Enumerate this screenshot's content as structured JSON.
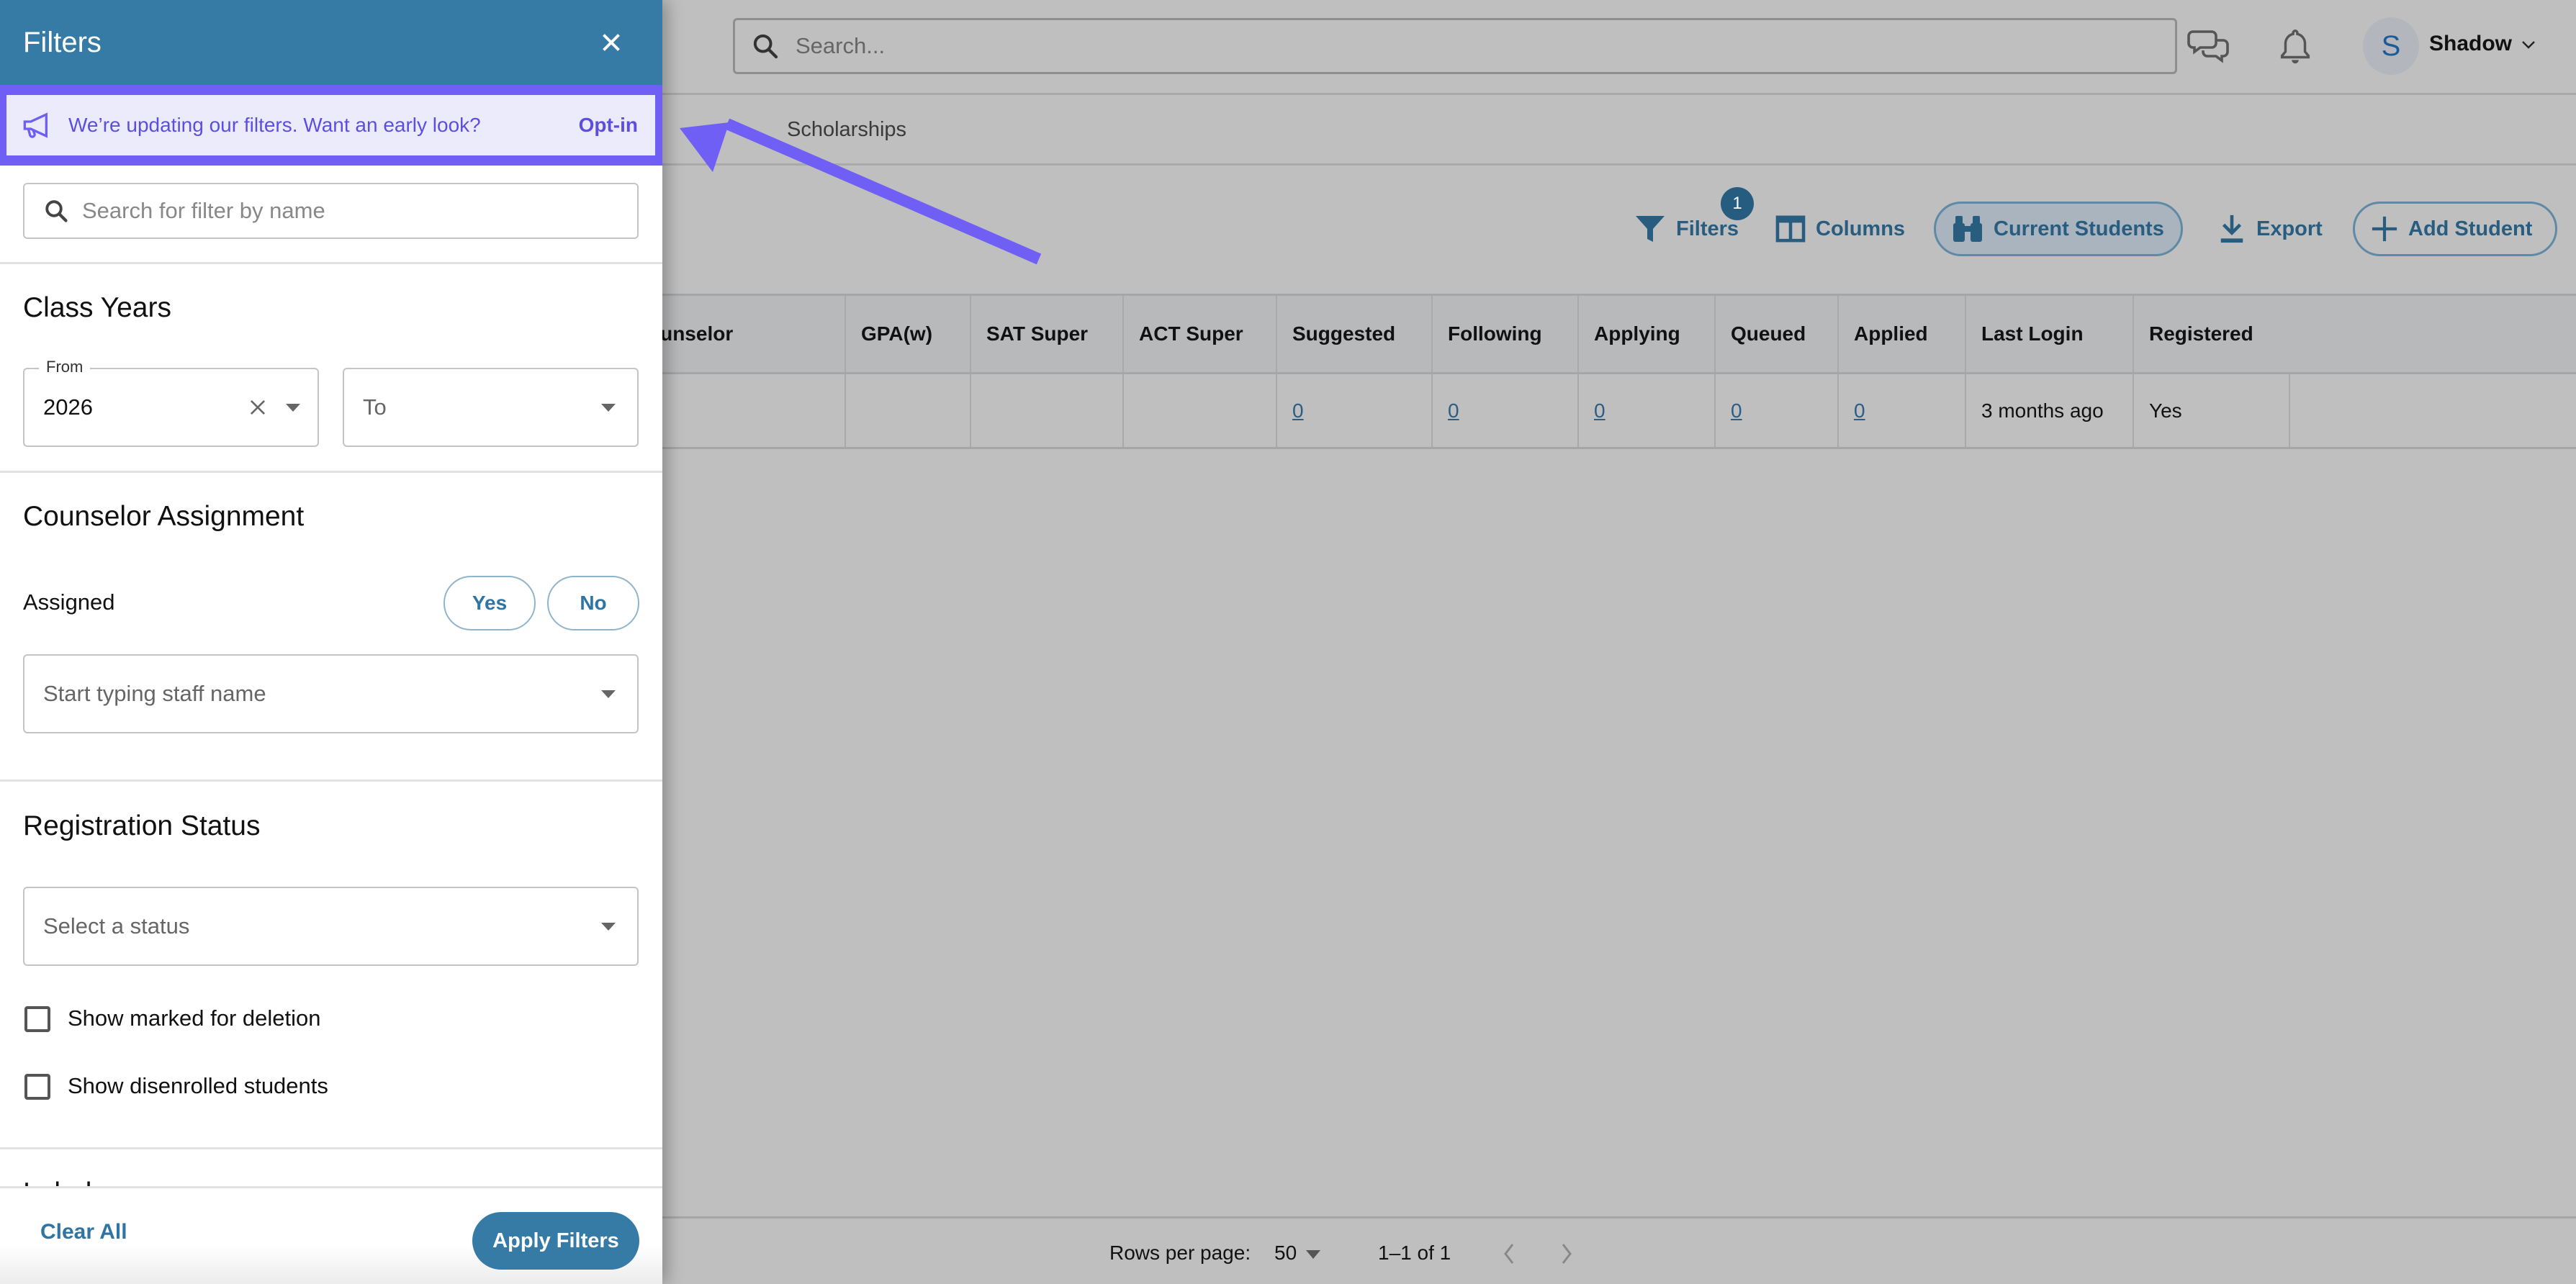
{
  "header": {
    "search_placeholder": "Search...",
    "user_initial": "S",
    "user_name": "Shadow"
  },
  "tabs": [
    {
      "label": "Scholarships"
    }
  ],
  "toolbar": {
    "filters_label": "Filters",
    "filters_badge": "1",
    "columns_label": "Columns",
    "current_students_label": "Current Students",
    "export_label": "Export",
    "add_student_label": "Add Student"
  },
  "table": {
    "columns": [
      "ounselor",
      "GPA(w)",
      "SAT Super",
      "ACT Super",
      "Suggested",
      "Following",
      "Applying",
      "Queued",
      "Applied",
      "Last Login",
      "Registered"
    ],
    "rows": [
      {
        "counselor": "",
        "gpa": "",
        "sat": "",
        "act": "",
        "suggested": "0",
        "following": "0",
        "applying": "0",
        "queued": "0",
        "applied": "0",
        "last_login": "3 months ago",
        "registered": "Yes"
      }
    ]
  },
  "pagination": {
    "rows_per_page_label": "Rows per page:",
    "rows_per_page_value": "50",
    "range": "1–1 of 1"
  },
  "filters_panel": {
    "title": "Filters",
    "banner": {
      "text": "We’re updating our filters. Want an early look?",
      "action": "Opt-in"
    },
    "search_placeholder": "Search for filter by name",
    "class_years": {
      "title": "Class Years",
      "from_label": "From",
      "from_value": "2026",
      "to_placeholder": "To"
    },
    "counselor_assignment": {
      "title": "Counselor Assignment",
      "assigned_label": "Assigned",
      "yes_label": "Yes",
      "no_label": "No",
      "staff_placeholder": "Start typing staff name"
    },
    "registration_status": {
      "title": "Registration Status",
      "status_placeholder": "Select a status",
      "show_marked_for_deletion": {
        "label": "Show marked for deletion",
        "checked": false
      },
      "show_disenrolled": {
        "label": "Show disenrolled students",
        "checked": false
      }
    },
    "next_section_title": "Labels",
    "clear_all_label": "Clear All",
    "apply_label": "Apply Filters"
  },
  "colors": {
    "panel_header": "#357ba5",
    "annotation": "#6f5ff5",
    "banner_bg": "#ecebfc",
    "link": "#2a5e86"
  }
}
